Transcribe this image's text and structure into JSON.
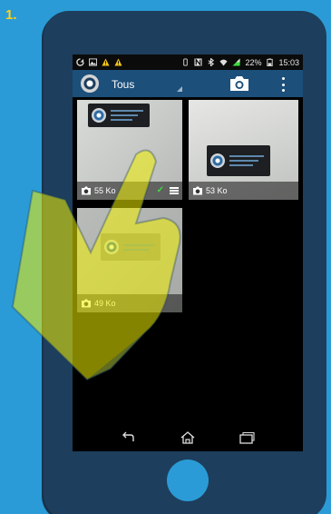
{
  "step": {
    "number": "1."
  },
  "statusbar": {
    "battery_percent": "22%",
    "time": "15:03",
    "icons": [
      "sync-icon",
      "image-icon",
      "warning-icon",
      "warning-icon",
      "vibrate-icon",
      "nfc-icon",
      "bluetooth-icon",
      "wifi-icon",
      "signal-icon",
      "battery-icon"
    ]
  },
  "actionbar": {
    "filter_label": "Tous",
    "icons": [
      "app-logo-icon",
      "camera-icon",
      "overflow-menu-icon"
    ]
  },
  "gallery": {
    "items": [
      {
        "size": "55 Ko",
        "synced": true
      },
      {
        "size": "53 Ko",
        "synced": false
      },
      {
        "size": "49 Ko",
        "synced": false
      }
    ]
  },
  "navbar": {
    "icons": [
      "back-icon",
      "home-icon",
      "recent-apps-icon"
    ]
  },
  "colors": {
    "background": "#2a9bd6",
    "phone_body": "#1d3e5c",
    "actionbar": "#1c4f7a",
    "step_number": "#ffd21a",
    "check": "#3ddc3d",
    "hand_overlay": "#f3f000"
  }
}
